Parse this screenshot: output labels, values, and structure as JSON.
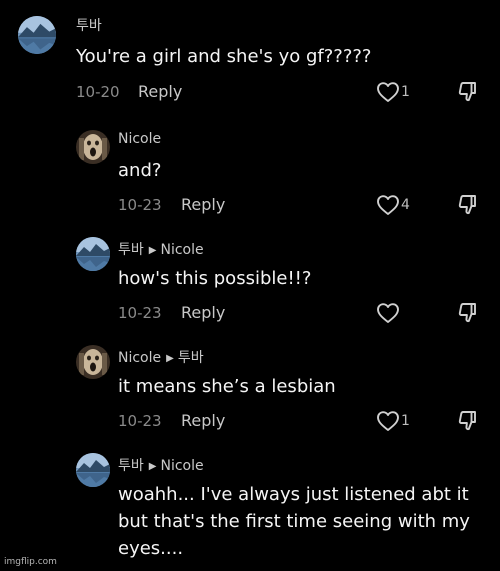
{
  "comments": [
    {
      "username": "투바",
      "reply_to": "",
      "text": "You're a girl and she's yo gf?????",
      "date": "10-20",
      "reply_label": "Reply",
      "likes": "1",
      "avatar_icon": "lake-mountain-avatar"
    },
    {
      "username": "Nicole",
      "reply_to": "",
      "text": "and?",
      "date": "10-23",
      "reply_label": "Reply",
      "likes": "4",
      "avatar_icon": "screaming-face-avatar"
    },
    {
      "username": "투바",
      "reply_to": "Nicole",
      "text": "how's this possible!!?",
      "date": "10-23",
      "reply_label": "Reply",
      "likes": "",
      "avatar_icon": "lake-mountain-avatar"
    },
    {
      "username": "Nicole",
      "reply_to": "투바",
      "text": "it means she’s a lesbian",
      "date": "10-23",
      "reply_label": "Reply",
      "likes": "1",
      "avatar_icon": "screaming-face-avatar"
    },
    {
      "username": "투바",
      "reply_to": "Nicole",
      "text": "woahh... I've always just listened abt it but that's the first time seeing with my eyes....",
      "date": "",
      "reply_label": "",
      "likes": "",
      "avatar_icon": "lake-mountain-avatar"
    }
  ],
  "watermark": "imgflip.com",
  "colors": {
    "background": "#000000",
    "text": "#f5f5f5",
    "muted": "#8a8a8a"
  }
}
